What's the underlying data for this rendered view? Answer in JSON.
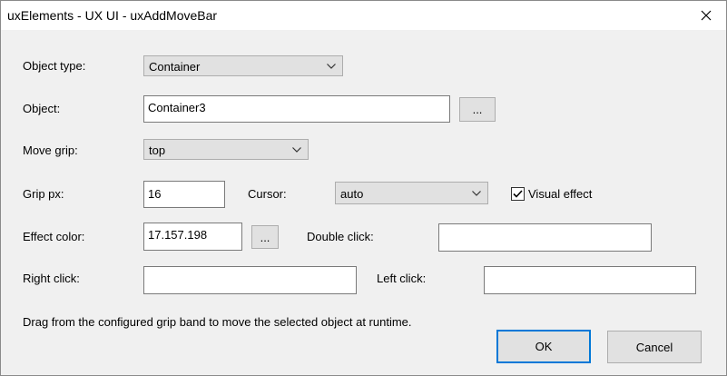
{
  "window": {
    "title": "uxElements - UX UI - uxAddMoveBar"
  },
  "form": {
    "object_type": {
      "label": "Object type:",
      "value": "Container"
    },
    "object": {
      "label": "Object:",
      "value": "Container3",
      "browse_label": "..."
    },
    "move_grip": {
      "label": "Move grip:",
      "value": "top"
    },
    "grip_px": {
      "label": "Grip px:",
      "value": "16"
    },
    "cursor": {
      "label": "Cursor:",
      "value": "auto"
    },
    "visual_effect": {
      "label": "Visual effect",
      "checked": true
    },
    "effect_color": {
      "label": "Effect color:",
      "value": "17.157.198",
      "browse_label": "..."
    },
    "double_click": {
      "label": "Double click:",
      "value": ""
    },
    "right_click": {
      "label": "Right click:",
      "value": ""
    },
    "left_click": {
      "label": "Left click:",
      "value": ""
    }
  },
  "hint": "Drag from the configured grip band to move the selected object at runtime.",
  "buttons": {
    "ok": "OK",
    "cancel": "Cancel"
  },
  "colors": {
    "accent": "#0078d7",
    "button_face": "#e1e1e1",
    "window_bg": "#f0f0f0"
  }
}
